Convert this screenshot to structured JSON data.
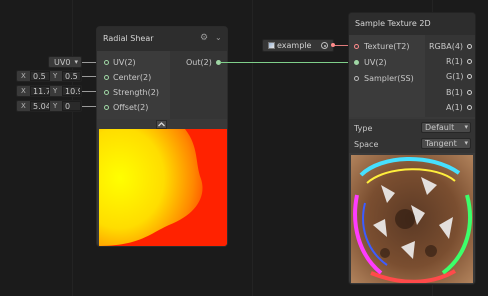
{
  "radial_shear": {
    "title": "Radial Shear",
    "inputs": [
      "UV(2)",
      "Center(2)",
      "Strength(2)",
      "Offset(2)"
    ],
    "output": "Out(2)",
    "preview_toggle_icon": "chevron-up-icon"
  },
  "inline_inputs": {
    "uv_dropdown": "UV0",
    "center": {
      "x_label": "X",
      "x": "0.5",
      "y_label": "Y",
      "y": "0.5"
    },
    "strength": {
      "x_label": "X",
      "x": "11.7",
      "y_label": "Y",
      "y": "10.9"
    },
    "offset": {
      "x_label": "X",
      "x": "5.04",
      "y_label": "Y",
      "y": "0"
    }
  },
  "texture_property": {
    "label": "example"
  },
  "sample_texture": {
    "title": "Sample Texture 2D",
    "inputs": [
      "Texture(T2)",
      "UV(2)",
      "Sampler(SS)"
    ],
    "outputs": [
      "RGBA(4)",
      "R(1)",
      "G(1)",
      "B(1)",
      "A(1)"
    ],
    "type_label": "Type",
    "type_value": "Default",
    "space_label": "Space",
    "space_value": "Tangent"
  },
  "colors": {
    "uv_port": "#9fd6a4",
    "texture_port": "#ff8b8b",
    "edge_uv": "#7fcf8a",
    "edge_texture": "#e07b7b",
    "selection": "#44c0ff"
  }
}
